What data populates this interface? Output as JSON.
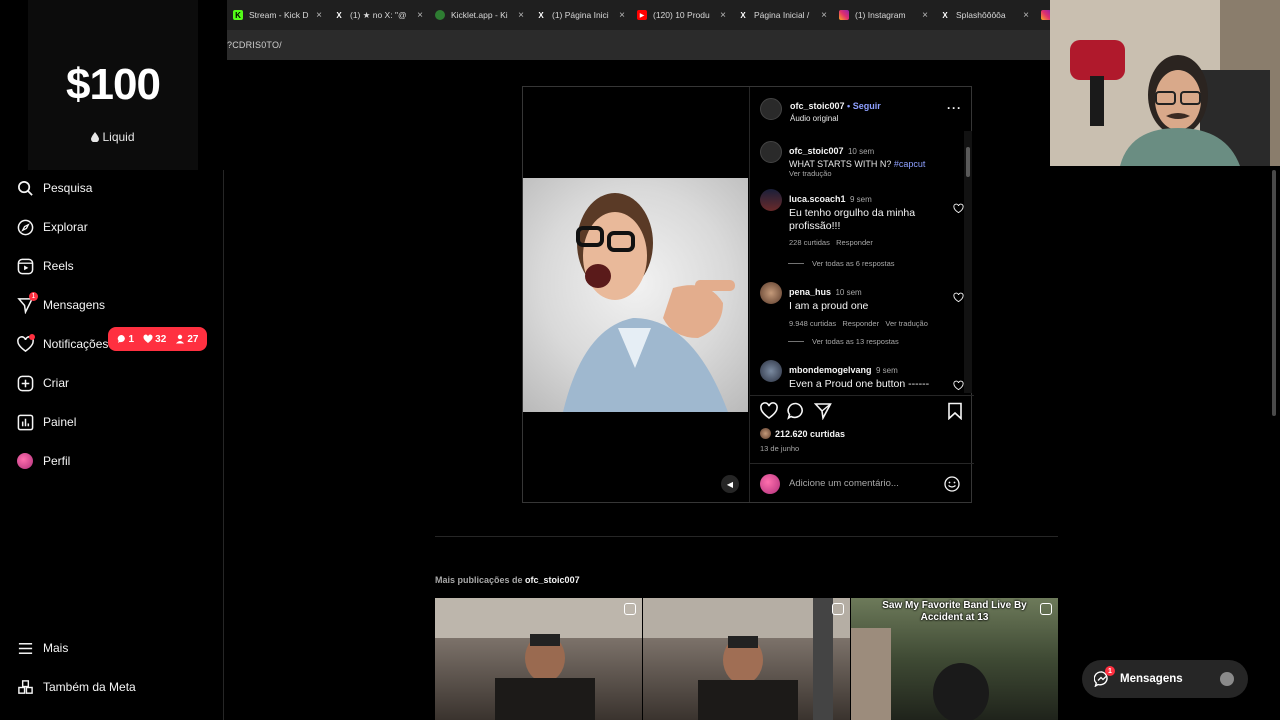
{
  "browser": {
    "tabs": [
      {
        "title": "Stream - Kick D",
        "favicon": "kick-icon",
        "color": "#53fc18",
        "glyph": "K"
      },
      {
        "title": "(1) ★ no X: \"@",
        "favicon": "x-icon",
        "color": "#000000",
        "glyph": "X"
      },
      {
        "title": "Kicklet.app - Ki",
        "favicon": "kicklet-icon",
        "color": "#2e7d32",
        "glyph": "●"
      },
      {
        "title": "(1) Página Inici",
        "favicon": "x-icon",
        "color": "#000000",
        "glyph": "X"
      },
      {
        "title": "(120) 10 Produ",
        "favicon": "youtube-icon",
        "color": "#ff0000",
        "glyph": "▶"
      },
      {
        "title": "Página Inicial /",
        "favicon": "x-icon",
        "color": "#000000",
        "glyph": "X"
      },
      {
        "title": "(1) Instagram",
        "favicon": "instagram-icon",
        "color": "#e1306c",
        "glyph": "◎"
      },
      {
        "title": "Splashôôôôa",
        "favicon": "x-icon",
        "color": "#000000",
        "glyph": "X"
      }
    ],
    "url_fragment": "?CDRIS0TO/"
  },
  "donation": {
    "amount": "$100",
    "brand": "Liquid"
  },
  "sidebar": {
    "items": [
      {
        "label": "Pesquisa",
        "icon": "search-icon"
      },
      {
        "label": "Explorar",
        "icon": "compass-icon"
      },
      {
        "label": "Reels",
        "icon": "reels-icon"
      },
      {
        "label": "Mensagens",
        "icon": "messenger-icon",
        "badge": "1"
      },
      {
        "label": "Notificações",
        "icon": "heart-icon"
      },
      {
        "label": "Criar",
        "icon": "plus-square-icon"
      },
      {
        "label": "Painel",
        "icon": "dashboard-icon"
      },
      {
        "label": "Perfil",
        "icon": "profile-avatar"
      },
      {
        "label": "Mais",
        "icon": "menu-icon"
      },
      {
        "label": "Também da Meta",
        "icon": "meta-icon"
      }
    ],
    "notifications_pill": {
      "comments": "1",
      "likes": "32",
      "follows": "27"
    }
  },
  "post": {
    "author": "ofc_stoic007",
    "follow_label": "Seguir",
    "audio": "Áudio original",
    "caption": {
      "user": "ofc_stoic007",
      "time": "10 sem",
      "text": "WHAT STARTS WITH N?",
      "hashtag": "#capcut",
      "translate": "Ver tradução"
    },
    "comments": [
      {
        "user": "luca.scoach1",
        "time": "9 sem",
        "text": "Eu tenho orgulho da minha profissão!!!",
        "likes": "228 curtidas",
        "reply": "Responder",
        "translate": "",
        "replies": "Ver todas as 6 respostas"
      },
      {
        "user": "pena_hus",
        "time": "10 sem",
        "text": "I am a proud one",
        "likes": "9.948 curtidas",
        "reply": "Responder",
        "translate": "Ver tradução",
        "replies": "Ver todas as 13 respostas"
      },
      {
        "user": "mbondemogelvang",
        "time": "9 sem",
        "text": "Even a Proud one button ------",
        "likes": "",
        "reply": "",
        "translate": "",
        "replies": ""
      }
    ],
    "likes_count": "212.620 curtidas",
    "date": "13 de junho",
    "add_comment_placeholder": "Adicione um comentário..."
  },
  "more_posts": {
    "prefix": "Mais publicações de",
    "user": "ofc_stoic007",
    "items": [
      {
        "caption": ""
      },
      {
        "caption": ""
      },
      {
        "caption": "Saw My Favorite Band Live By Accident at 13"
      }
    ]
  },
  "messages_button": {
    "label": "Mensagens",
    "badge": "1"
  }
}
